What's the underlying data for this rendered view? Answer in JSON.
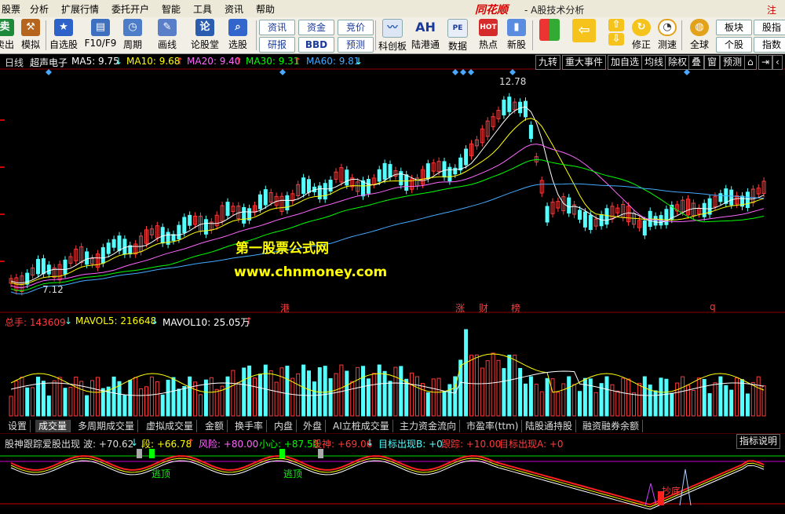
{
  "menu": [
    "股票",
    "分析",
    "扩展行情",
    "委托开户",
    "智能",
    "工具",
    "资讯",
    "帮助"
  ],
  "brand": "同花顺",
  "app_title": "- A股技术分析",
  "register": "注册",
  "toolbar": {
    "left_cut": [
      "卖出",
      "模拟"
    ],
    "buttons": [
      "自选股",
      "F10/F9",
      "周期",
      "画线",
      "论股堂",
      "选股"
    ],
    "small": [
      "资讯",
      "资金",
      "竞价",
      "研报",
      "BBD",
      "预测"
    ],
    "buttons2": [
      "科创板",
      "陆港通",
      "数据",
      "热点",
      "新股"
    ],
    "ah_label": "AH",
    "nav": [
      "修正",
      "测速"
    ],
    "global": "全球",
    "right": [
      "板块",
      "股指",
      "个股",
      "指数"
    ]
  },
  "info": {
    "period": "日线",
    "stock": "超声电子",
    "ma5": "MA5: 9.75",
    "ma10": "MA10: 9.68",
    "ma20": "MA20: 9.40",
    "ma30": "MA30: 9.31",
    "ma60": "MA60: 9.81",
    "right_buttons": [
      "九转",
      "重大事件",
      "加自选",
      "均线",
      "除权",
      "叠",
      "窗",
      "预测"
    ]
  },
  "price_labels": {
    "high": "12.78",
    "low": "7.12"
  },
  "event_marks": [
    "港",
    "涨",
    "财",
    "榜",
    "q"
  ],
  "watermark": {
    "line1": "第一股票公式网",
    "line2": "www.chnmoney.com"
  },
  "volume": {
    "total": "总手: 143609",
    "mavol5": "MAVOL5: 216648",
    "mavol10": "MAVOL10: 25.05万"
  },
  "tabs": [
    "设置",
    "成交量",
    "多周期成交量",
    "虚拟成交量",
    "金额",
    "换手率",
    "内盘",
    "外盘",
    "AI立桩成交量",
    "主力资金流向",
    "市盈率(ttm)",
    "陆股通持股",
    "融资融券余额"
  ],
  "indicator": {
    "name": "股神跟踪爱股出现",
    "bo": "波: +70.62",
    "duan": "段: +66.78",
    "fengxian": "风险: +80.00",
    "xiaoxin": "小心: +87.50",
    "gushen": "股神: +69.06",
    "target_b": "目标出现B: +0",
    "genzong": "跟踪: +10.00",
    "target_a": "目标出现A: +0",
    "help": "指标说明",
    "labels": [
      "逃顶",
      "逃顶",
      "抄底"
    ]
  },
  "colors": {
    "up": "#ff3b3b",
    "down": "#54ffff",
    "ma5": "#ffffff",
    "ma10": "#ffff00",
    "ma20": "#ff66ff",
    "ma30": "#00ff00",
    "ma60": "#44aaff"
  }
}
